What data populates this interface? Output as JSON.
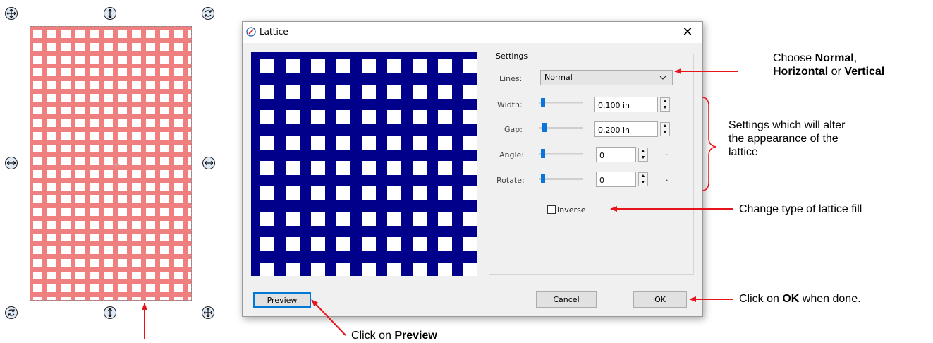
{
  "dialog": {
    "title": "Lattice",
    "close_symbol": "✕",
    "settings_group_label": "Settings",
    "lines_label": "Lines:",
    "lines_value": "Normal",
    "width_label": "Width:",
    "width_value": "0.100 in",
    "gap_label": "Gap:",
    "gap_value": "0.200 in",
    "angle_label": "Angle:",
    "angle_value": "0",
    "angle_unit": "·",
    "rotate_label": "Rotate:",
    "rotate_value": "0",
    "rotate_unit": "·",
    "inverse_label": "Inverse",
    "inverse_checked": false,
    "preview_button": "Preview",
    "cancel_button": "Cancel",
    "ok_button": "OK",
    "preview_colors": {
      "lines": "#00008b",
      "gaps": "#ffffff"
    }
  },
  "canvas_object": {
    "fill": "#f08080",
    "handle_color": "#dfe9f6"
  },
  "annotations": {
    "lines_choice": [
      "Choose ",
      "Normal",
      ", ",
      "Horizontal",
      " or ",
      "Vertical"
    ],
    "settings_note": [
      "Settings which will alter",
      "the appearance of the",
      "lattice"
    ],
    "inverse_note": "Change type of lattice fill",
    "ok_note": [
      "Click on ",
      "OK",
      " when done."
    ],
    "preview_note": [
      "Click on ",
      "Preview"
    ],
    "arrow_color": "#e8141c"
  }
}
